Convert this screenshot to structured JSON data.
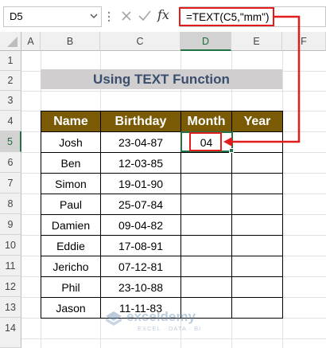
{
  "namebox": {
    "value": "D5"
  },
  "formula_bar": {
    "formula": "=TEXT(C5,\"mm\")",
    "fx_label": "fx"
  },
  "columns": [
    "A",
    "B",
    "C",
    "D",
    "E",
    "F"
  ],
  "rows": [
    "1",
    "2",
    "3",
    "4",
    "5",
    "6",
    "7",
    "8",
    "9",
    "10",
    "11",
    "12",
    "13",
    "14"
  ],
  "selected_column": "D",
  "selected_row": "5",
  "sheet": {
    "title": "Using TEXT Function",
    "headers": [
      "Name",
      "Birthday",
      "Month",
      "Year"
    ],
    "data": [
      [
        "Josh",
        "23-04-87",
        "04",
        ""
      ],
      [
        "Ben",
        "12-03-85",
        "",
        ""
      ],
      [
        "Simon",
        "19-01-90",
        "",
        ""
      ],
      [
        "Paul",
        "25-07-84",
        "",
        ""
      ],
      [
        "Damien",
        "09-04-82",
        "",
        ""
      ],
      [
        "Eddie",
        "17-08-91",
        "",
        ""
      ],
      [
        "Jericho",
        "07-12-81",
        "",
        ""
      ],
      [
        "Phil",
        "23-10-88",
        "",
        ""
      ],
      [
        "Jason",
        "11-11-83",
        "",
        ""
      ]
    ]
  },
  "watermark": {
    "name": "exceldemy",
    "tagline": "EXCEL · DATA · BI"
  },
  "colors": {
    "header_fill": "#7b5a06",
    "title_fill": "#d0cece",
    "title_text": "#3a4f6e",
    "highlight": "#e21b1b",
    "selection": "#217346"
  },
  "icons": {
    "namebox_caret": "chevron-down-icon",
    "cancel": "close-icon",
    "enter": "check-icon",
    "dots": "more-vertical-icon"
  }
}
